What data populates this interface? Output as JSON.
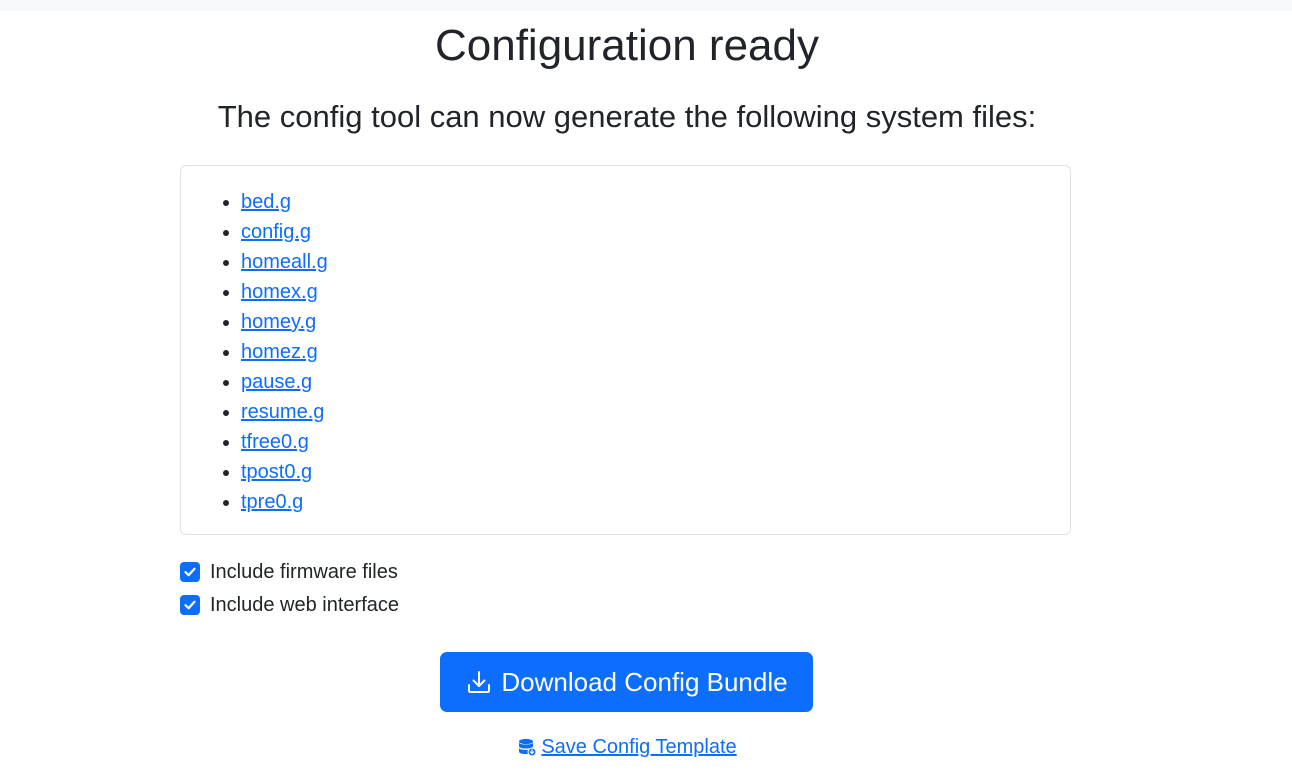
{
  "header": {
    "title": "Configuration ready",
    "subtitle": "The config tool can now generate the following system files:"
  },
  "files": [
    "bed.g",
    "config.g",
    "homeall.g",
    "homex.g",
    "homey.g",
    "homez.g",
    "pause.g",
    "resume.g",
    "tfree0.g",
    "tpost0.g",
    "tpre0.g"
  ],
  "options": {
    "firmware": {
      "label": "Include firmware files",
      "checked": true
    },
    "web_interface": {
      "label": "Include web interface",
      "checked": true
    }
  },
  "actions": {
    "download_label": "Download Config Bundle",
    "download_icon": "download-icon",
    "save_template_label": "Save Config Template",
    "save_template_icon": "database-icon"
  },
  "colors": {
    "accent": "#0d6efd",
    "text": "#212529",
    "border": "#dee2e6"
  }
}
